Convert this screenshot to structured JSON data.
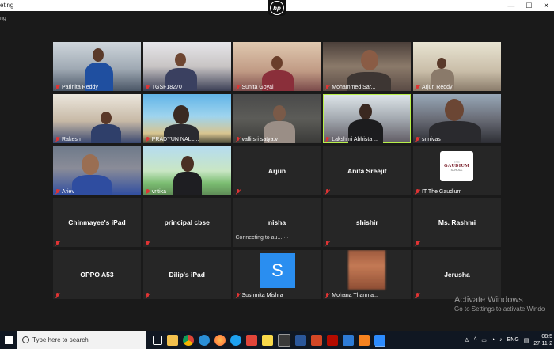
{
  "window": {
    "title": "eting",
    "subtitle": "ng",
    "controls": [
      "—",
      "☐",
      "✕"
    ]
  },
  "brand": {
    "hp_logo": "hp"
  },
  "grid": {
    "tiles": [
      {
        "name": "Parinita Reddy",
        "video": true
      },
      {
        "name": "TGSF18270",
        "video": true
      },
      {
        "name": "Sunita Goyal",
        "video": true
      },
      {
        "name": "Mohammed Sar...",
        "video": true
      },
      {
        "name": "Arjun Reddy",
        "video": true
      },
      {
        "name": "Rakesh",
        "video": true
      },
      {
        "name": "PRADYUN NALL...",
        "video": true
      },
      {
        "name": "valli sri satya.v",
        "video": true
      },
      {
        "name": "Lakshmi Abhista ...",
        "video": true,
        "active_speaker": true
      },
      {
        "name": "srinivas",
        "video": true
      },
      {
        "name": "Ariev",
        "video": true
      },
      {
        "name": "vritika",
        "video": true
      },
      {
        "name": "Arjun",
        "video": false
      },
      {
        "name": "Anita Sreejit",
        "video": false
      },
      {
        "name": "IT The Gaudium",
        "video": false,
        "logo_text": "GAUDIUM",
        "logo_top": "THE",
        "logo_sub": "SCHOOL"
      },
      {
        "name": "Chinmayee's iPad",
        "video": false
      },
      {
        "name": "principal cbse",
        "video": false
      },
      {
        "name": "nisha",
        "video": false,
        "status": "Connecting to au... ·.·"
      },
      {
        "name": "shishir",
        "video": false
      },
      {
        "name": "Ms. Rashmi",
        "video": false
      },
      {
        "name": "OPPO A53",
        "video": false
      },
      {
        "name": "Dilip's iPad",
        "video": false
      },
      {
        "name": "Sushmita Mishra",
        "video": false,
        "avatar_letter": "S"
      },
      {
        "name": "Mohana Thanma...",
        "video": true
      },
      {
        "name": "Jerusha",
        "video": false
      }
    ]
  },
  "watermark": {
    "line1": "Activate Windows",
    "line2": "Go to Settings to activate Windo"
  },
  "taskbar": {
    "search_placeholder": "Type here to search",
    "tray_lang": "ENG",
    "time": "08:5",
    "date": "27-11-2"
  },
  "colors": {
    "active_speaker": "#b8f04a",
    "mic_muted": "#e03434",
    "avatar_blue": "#2a8ef0",
    "tile_bg": "#262626"
  }
}
